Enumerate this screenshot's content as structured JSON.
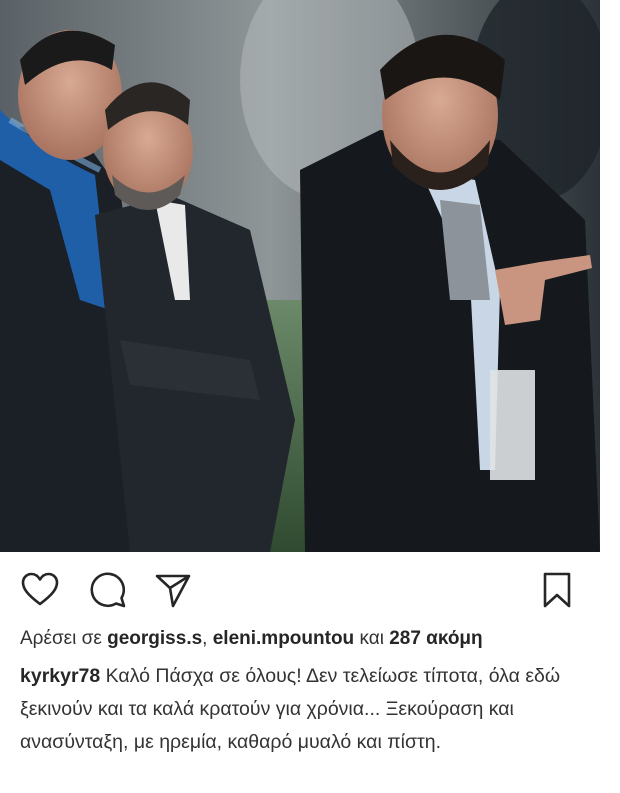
{
  "post": {
    "photo": {
      "alt_icon": "photo"
    },
    "actions": {
      "like_icon": "heart-icon",
      "comment_icon": "comment-icon",
      "share_icon": "share-icon",
      "save_icon": "bookmark-icon"
    },
    "likes": {
      "prefix": "Αρέσει σε ",
      "user1": "georgiss.s",
      "separator": ", ",
      "user2": "eleni.mpountou",
      "conjunction": " και ",
      "more": "287 ακόμη"
    },
    "caption": {
      "username": "kyrkyr78",
      "text": " Καλό Πάσχα σε όλους! Δεν τελείωσε τίποτα, όλα εδώ ξεκινούν και τα καλά κρατούν για χρόνια... Ξεκούραση και ανασύνταξη, με ηρεμία, καθαρό μυαλό και πίστη."
    },
    "colors": {
      "text": "#262626",
      "icon": "#262626"
    }
  }
}
